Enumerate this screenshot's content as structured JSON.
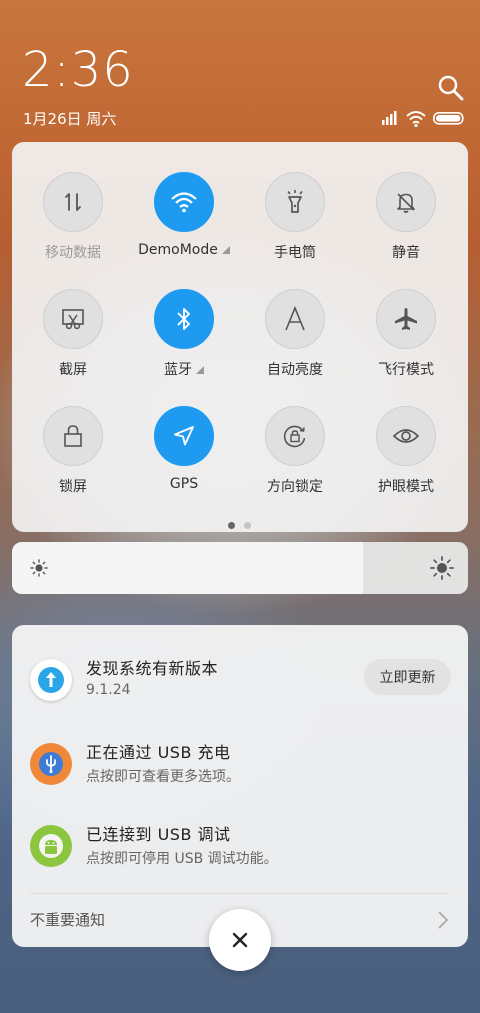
{
  "status_bar": {
    "time": "2:36",
    "date": "1月26日 周六",
    "icons": [
      "search-icon",
      "signal-icon",
      "wifi-icon",
      "battery-icon"
    ]
  },
  "quick_settings": {
    "tiles": [
      {
        "label": "移动数据",
        "icon": "mobile-data-icon",
        "active": false,
        "enabled": false
      },
      {
        "label": "DemoMode",
        "icon": "wifi-icon",
        "active": true,
        "enabled": true,
        "expandable": true
      },
      {
        "label": "手电筒",
        "icon": "flashlight-icon",
        "active": false,
        "enabled": true
      },
      {
        "label": "静音",
        "icon": "bell-off-icon",
        "active": false,
        "enabled": true
      },
      {
        "label": "截屏",
        "icon": "screenshot-icon",
        "active": false,
        "enabled": true
      },
      {
        "label": "蓝牙",
        "icon": "bluetooth-icon",
        "active": true,
        "enabled": true,
        "expandable": true
      },
      {
        "label": "自动亮度",
        "icon": "auto-brightness-icon",
        "active": false,
        "enabled": true
      },
      {
        "label": "飞行模式",
        "icon": "airplane-icon",
        "active": false,
        "enabled": true
      },
      {
        "label": "锁屏",
        "icon": "lock-icon",
        "active": false,
        "enabled": true
      },
      {
        "label": "GPS",
        "icon": "gps-icon",
        "active": true,
        "enabled": true
      },
      {
        "label": "方向锁定",
        "icon": "rotation-lock-icon",
        "active": false,
        "enabled": true
      },
      {
        "label": "护眼模式",
        "icon": "eye-icon",
        "active": false,
        "enabled": true
      }
    ],
    "page_count": 2,
    "current_page": 1
  },
  "brightness": {
    "level": 0.77,
    "icons": [
      "brightness-low-icon",
      "brightness-high-icon"
    ]
  },
  "notifications": {
    "items": [
      {
        "title": "发现系统有新版本",
        "subtitle": "9.1.24",
        "icon": "system-update-icon",
        "action_label": "立即更新"
      },
      {
        "title": "正在通过 USB 充电",
        "subtitle": "点按即可查看更多选项。",
        "icon": "usb-icon"
      },
      {
        "title": "已连接到 USB 调试",
        "subtitle": "点按即可停用 USB 调试功能。",
        "icon": "android-icon"
      }
    ],
    "footer_label": "不重要通知"
  },
  "colors": {
    "active_tile": "#1e9bf0",
    "inactive_tile": "#e0e0e0",
    "usb_icon_bg": "#f0883a",
    "android_icon_bg": "#8cc63f",
    "update_icon_bg": "#2aa6e8"
  }
}
